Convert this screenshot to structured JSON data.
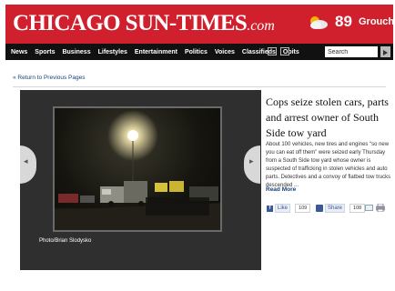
{
  "masthead": {
    "logo_main": "CHICAGO SUN-TIMES",
    "logo_suffix": ".com",
    "weather_icon": "partly-cloudy-icon",
    "temperature": "89",
    "weather_mood": "Grouchy"
  },
  "nav": {
    "items": [
      "News",
      "Sports",
      "Business",
      "Lifestyles",
      "Entertainment",
      "Politics",
      "Voices",
      "Classifieds",
      "Obits"
    ],
    "media_icons": [
      "video-icon",
      "camera-icon"
    ],
    "search_value": "Search"
  },
  "back_link": "« Return to Previous Pages",
  "gallery": {
    "photo_credit": "Photo/Brian Slodysko",
    "prev_arrow": "◂",
    "next_arrow": "▸"
  },
  "article": {
    "headline": "Cops seize stolen cars, parts and arrest owner of South Side tow yard",
    "summary": "About 100 vehicles, new tires and engines “so new you can eat off them” were seized early Thursday from a South Side tow yard whose owner is suspected of trafficking in stolen vehicles and auto parts. Detectives and a convoy of flatbed tow trucks descended ...",
    "read_more": "Read More"
  },
  "social": {
    "like_label": "Like",
    "like_count": "109",
    "share_label": "Share",
    "share_count": "108",
    "email_icon": "email-icon",
    "print_icon": "print-icon"
  },
  "colors": {
    "brand_red": "#d0202e",
    "nav_black": "#111111",
    "link_blue": "#14427a",
    "facebook_blue": "#3b5998"
  }
}
